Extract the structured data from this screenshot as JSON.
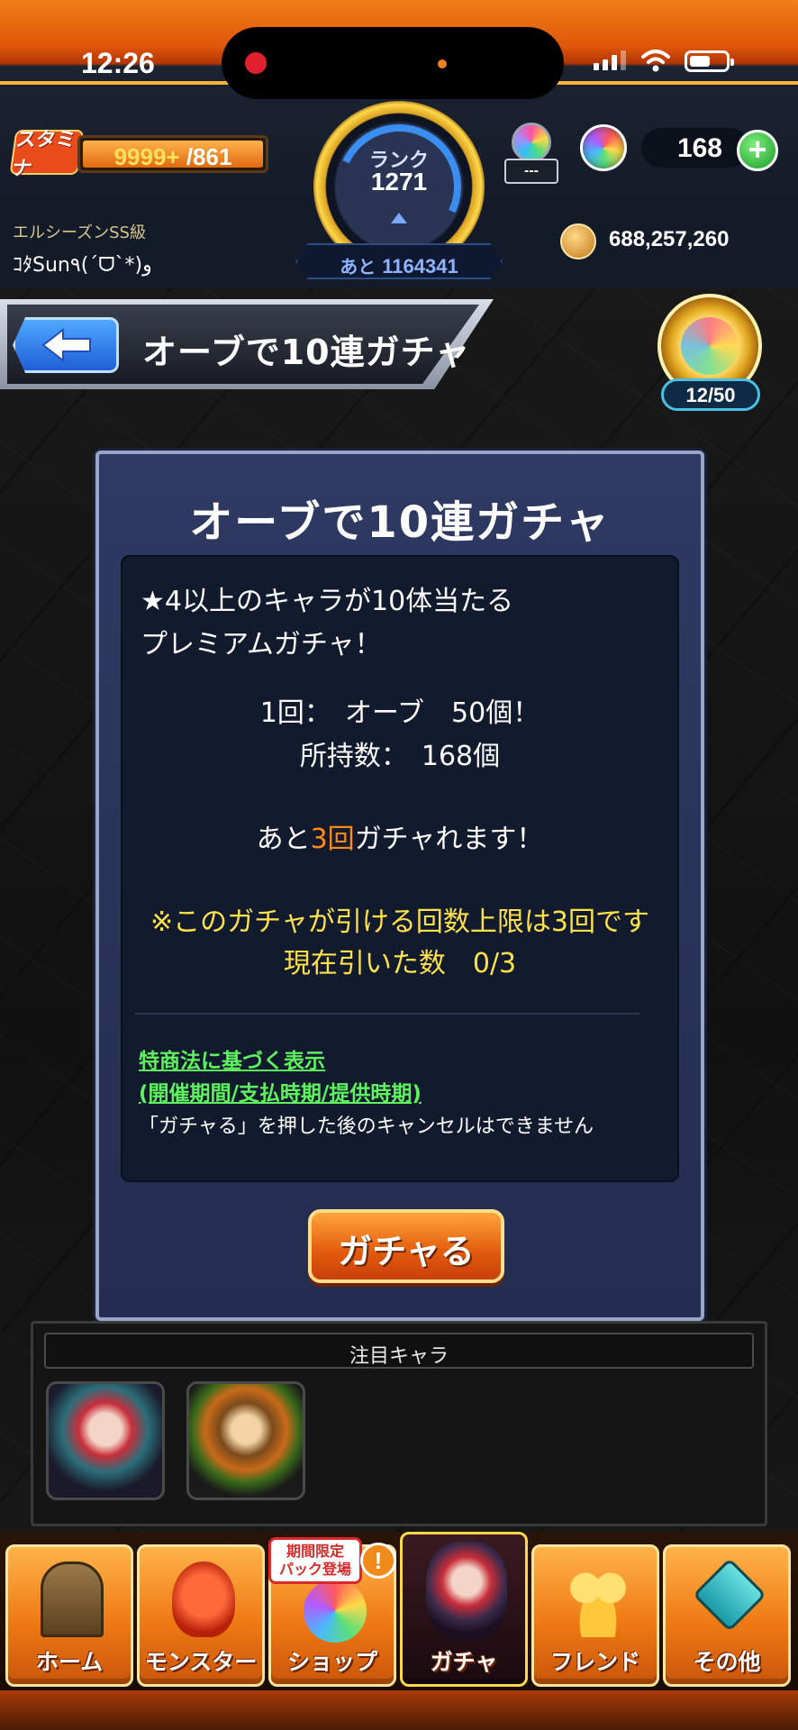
{
  "status_bar": {
    "time": "12:26"
  },
  "header": {
    "stamina_icon_text": "スタミナ",
    "stamina_current": "9999+",
    "stamina_max": "/861",
    "stamina_fill": 1.0,
    "rank_label": "ランク",
    "rank_value": "1271",
    "rank_next_prefix": "あと",
    "rank_next_value": "1164341",
    "season_label": "エルシーズンSS級",
    "player_name": "ｺﾀSun٩(ˊᗜˋ*)و",
    "item_count": "---",
    "orb_count": "168",
    "plus_label": "+",
    "coins": "688,257,260"
  },
  "title_bar": {
    "title": "オーブで10連ガチャ"
  },
  "badge": {
    "count": "12/50"
  },
  "panel": {
    "title": "オーブで10連ガチャ",
    "desc_line1": "★4以上のキャラが10体当たる",
    "desc_line2": "プレミアムガチャ！",
    "cost_line": "1回：　オーブ　50個！",
    "owned_line": "所持数：　168個",
    "remain_prefix": "あと",
    "remain_number": "3回",
    "remain_suffix": "ガチャれます！",
    "limit_line": "※このガチャが引ける回数上限は3回です",
    "drawn_line": "現在引いた数　0/3",
    "law_link1": "特商法に基づく表示",
    "law_link2": "(開催期間/支払時期/提供時期)",
    "cancel_note": "「ガチャる」を押した後のキャンセルはできません",
    "gacha_button": "ガチャる"
  },
  "featured": {
    "title": "注目キャラ"
  },
  "nav": {
    "promo_line1": "期間限定",
    "promo_line2": "パック登場",
    "promo_mark": "!",
    "tabs": [
      {
        "label": "ホーム"
      },
      {
        "label": "モンスター"
      },
      {
        "label": "ショップ"
      },
      {
        "label": "ガチャ"
      },
      {
        "label": "フレンド"
      },
      {
        "label": "その他"
      }
    ]
  },
  "colors": {
    "accent_orange": "#e8650d",
    "highlight_yellow": "#ffe24a",
    "link_green": "#5ef25e",
    "panel_blue": "#2e3a62"
  }
}
